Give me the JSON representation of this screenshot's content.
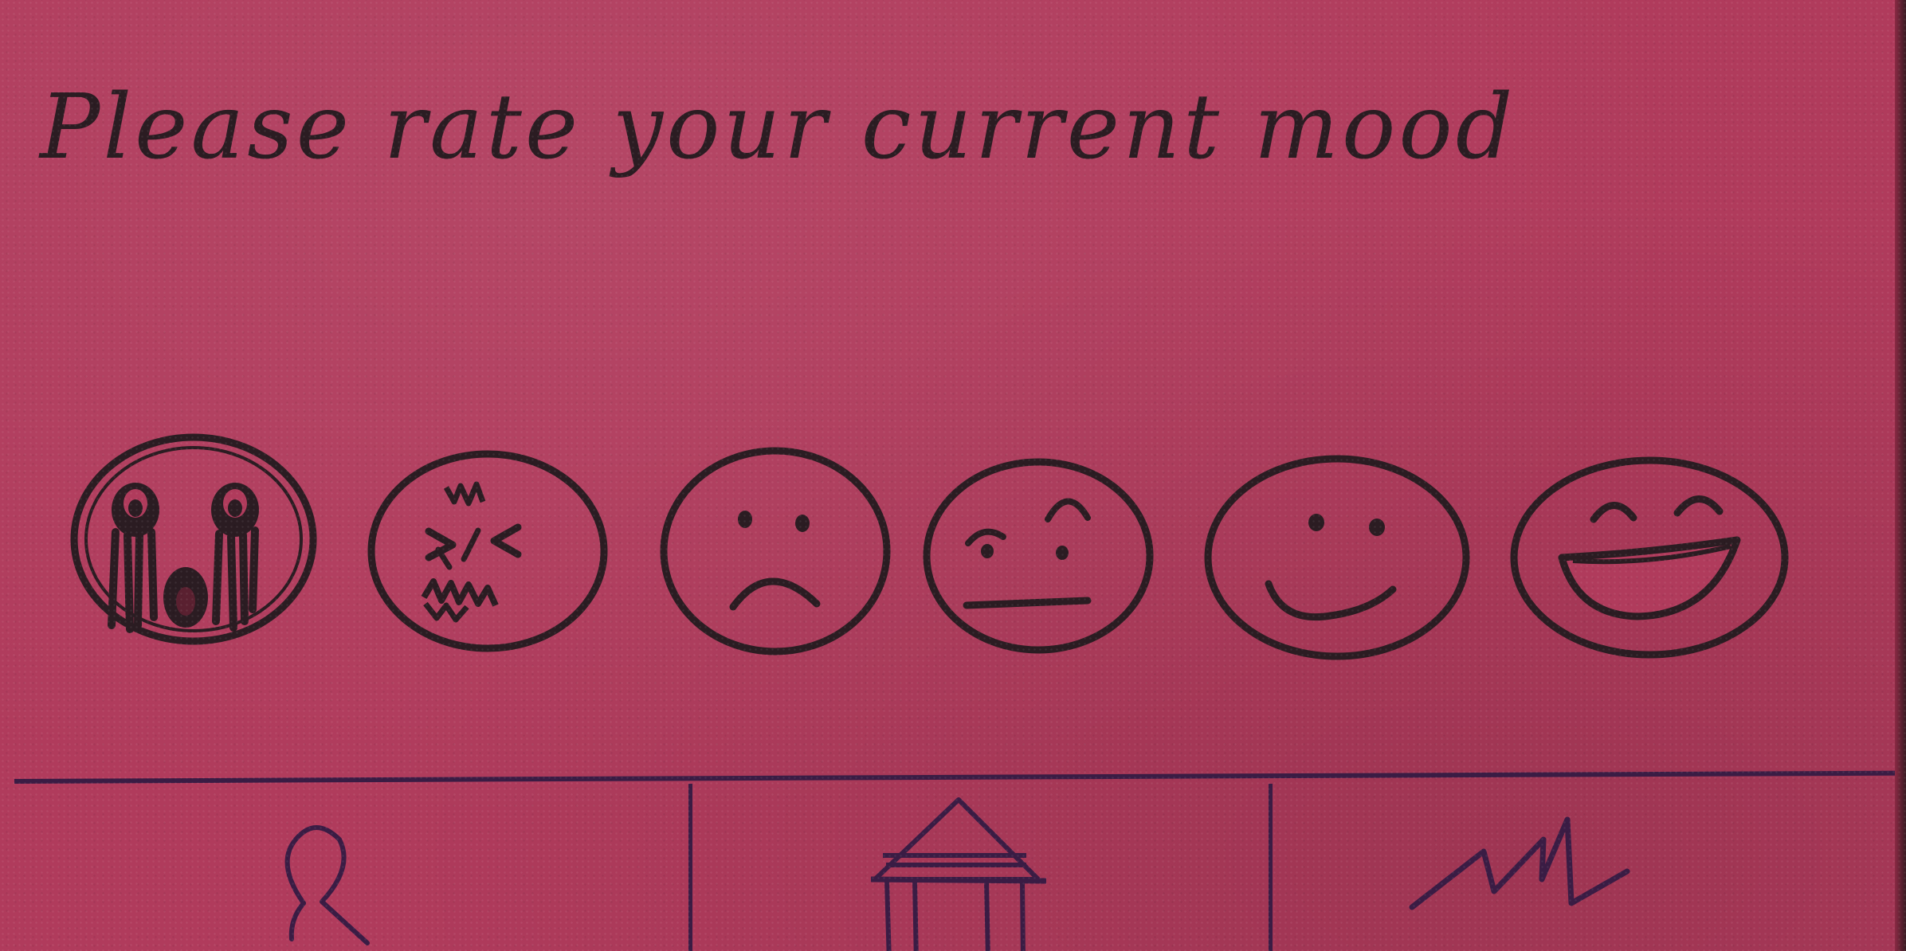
{
  "screen": {
    "prompt": "Please rate your current mood"
  },
  "mood_options": [
    {
      "icon": "crying-face-icon"
    },
    {
      "icon": "angry-face-icon"
    },
    {
      "icon": "sad-face-icon"
    },
    {
      "icon": "neutral-face-icon"
    },
    {
      "icon": "smiling-face-icon"
    },
    {
      "icon": "laughing-face-icon"
    }
  ],
  "bottom_nav": {
    "items": [
      {
        "icon": "profile-icon"
      },
      {
        "icon": "home-icon"
      },
      {
        "icon": "statistics-icon"
      }
    ]
  },
  "colors": {
    "card": "#b03b5c",
    "ink": "#2b1c22",
    "nav_ink": "#3a1c44"
  }
}
